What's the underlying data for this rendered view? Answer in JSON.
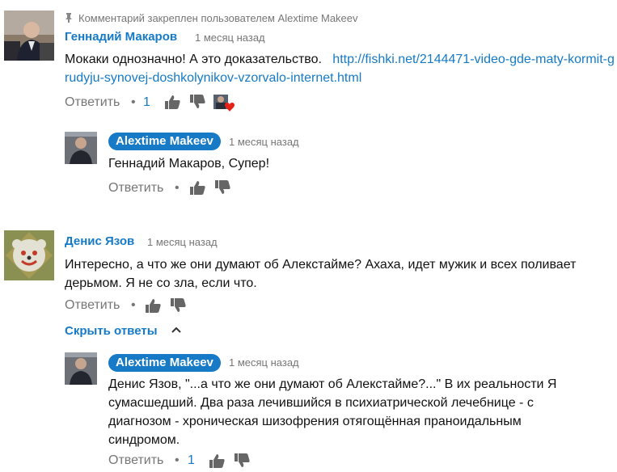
{
  "comments": [
    {
      "pinned_note": "Комментарий закреплен пользователем Alextime Makeev",
      "author": "Геннадий Макаров",
      "time": "1 месяц назад",
      "text": "Мокаки однозначно! А это доказательство.",
      "link_text": "http://fishki.net/2144471-video-gde-maty-kormit-grudyju-synovej-doshkolynikov-vzorvalo-internet.html",
      "reply_label": "Ответить",
      "likes": "1",
      "reply": {
        "author": "Alextime Makeev",
        "time": "1 месяц назад",
        "text": "Геннадий Макаров, Супер!",
        "reply_label": "Ответить"
      }
    },
    {
      "author": "Денис Язов",
      "time": "1 месяц назад",
      "text": "Интересно, а что же они думают об Алекстайме? Ахаха, идет мужик и всех поливает дерьмом. Я не со зла, если что.",
      "reply_label": "Ответить",
      "hide_replies_label": "Скрыть ответы",
      "reply": {
        "author": "Alextime Makeev",
        "time": "1 месяц назад",
        "text": "Денис Язов, \"...а что же они думают об Алекстайме?...\" В их реальности Я сумасшедший. Два раза лечившийся в психиатрической лечебнице - с диагнозом - хроническая шизофрения отягощённая праноидальным синдромом.",
        "reply_label": "Ответить",
        "likes": "1"
      }
    }
  ],
  "icons": {
    "pin": "pin-icon",
    "like": "thumbs-up-icon",
    "dislike": "thumbs-down-icon",
    "heart": "creator-heart-icon",
    "chevron": "chevron-up-icon"
  },
  "colors": {
    "link": "#167ac6",
    "muted": "#767676",
    "heart": "#e62117"
  }
}
